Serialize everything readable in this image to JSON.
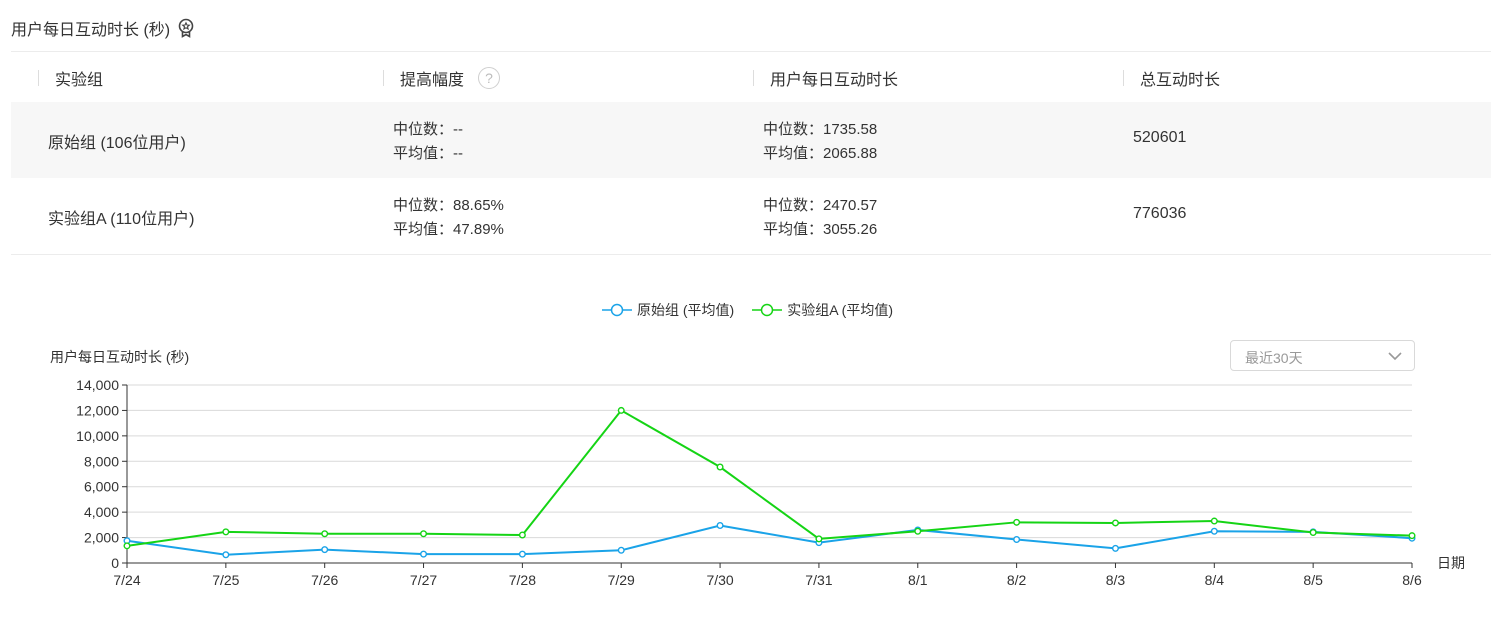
{
  "header": {
    "title": "用户每日互动时长 (秒)",
    "award_icon": "award-icon"
  },
  "table": {
    "columns": [
      "实验组",
      "提高幅度",
      "用户每日互动时长",
      "总互动时长"
    ],
    "rows": [
      {
        "group": "原始组 (106位用户)",
        "lift_median": "中位数：--",
        "lift_mean": "平均值：--",
        "daily_median": "中位数：1735.58",
        "daily_mean": "平均值：2065.88",
        "total": "520601"
      },
      {
        "group": "实验组A (110位用户)",
        "lift_median": "中位数：88.65%",
        "lift_mean": "平均值：47.89%",
        "daily_median": "中位数：2470.57",
        "daily_mean": "平均值：3055.26",
        "total": "776036"
      }
    ]
  },
  "range_select": {
    "value": "最近30天"
  },
  "colors": {
    "series1": "#1aa3e8",
    "series2": "#15d415",
    "grid": "#d9d9d9",
    "axis": "#333333"
  },
  "chart_data": {
    "type": "line",
    "title": "",
    "ylabel": "用户每日互动时长 (秒)",
    "xlabel": "日期",
    "ylim": [
      0,
      14000
    ],
    "yticks": [
      "0",
      "2,000",
      "4,000",
      "6,000",
      "8,000",
      "10,000",
      "12,000",
      "14,000"
    ],
    "categories": [
      "7/24",
      "7/25",
      "7/26",
      "7/27",
      "7/28",
      "7/29",
      "7/30",
      "7/31",
      "8/1",
      "8/2",
      "8/3",
      "8/4",
      "8/5",
      "8/6"
    ],
    "legend_position": "top-center",
    "grid": true,
    "series": [
      {
        "name": "原始组 (平均值)",
        "color": "#1aa3e8",
        "values": [
          1750,
          650,
          1050,
          700,
          700,
          1000,
          2950,
          1600,
          2600,
          1850,
          1150,
          2500,
          2450,
          1950
        ]
      },
      {
        "name": "实验组A (平均值)",
        "color": "#15d415",
        "values": [
          1350,
          2450,
          2300,
          2300,
          2200,
          12000,
          7550,
          1900,
          2500,
          3200,
          3150,
          3300,
          2400,
          2150
        ]
      }
    ]
  }
}
